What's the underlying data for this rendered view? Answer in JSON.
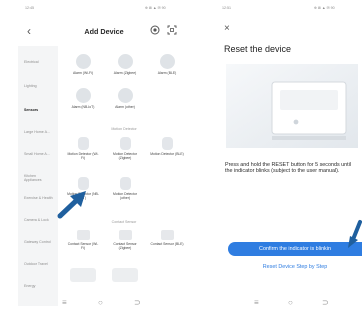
{
  "colors": {
    "accent": "#2f7de1",
    "arrow": "#1f5f9e",
    "sidebar_bg": "#f4f5f6"
  },
  "left": {
    "status_time": "12:45",
    "status_icons": "⊕ ⊠ ▲ ✉ 90",
    "title": "Add Device",
    "back_icon": "‹",
    "categories": [
      "Electrical",
      "Lighting",
      "Sensors",
      "Large Home A...",
      "Small Home A...",
      "Kitchen Appliances",
      "Exercise & Health",
      "Camera & Lock",
      "Gateway Control",
      "Outdoor Travel",
      "Energy"
    ],
    "active_category": "Sensors",
    "alarm_devices": [
      "Alarm (Wi-Fi)",
      "Alarm (Zigbee)",
      "Alarm (BLE)",
      "Alarm (NB-IoT)",
      "Alarm (other)"
    ],
    "motion_section_title": "Motion Detector",
    "motion_devices": [
      "Motion Detector (Wi-Fi)",
      "Motion Detector (Zigbee)",
      "Motion Detector (BLE)",
      "Motion Detector (NB-IoT)",
      "Motion Detector (other)"
    ],
    "contact_section_title": "Contact Sensor",
    "contact_devices": [
      "Contact Sensor (Wi-Fi)",
      "Contact Sensor (Zigbee)",
      "Contact Sensor (BLE)"
    ],
    "nav": [
      "≡",
      "○",
      "⊃"
    ]
  },
  "right": {
    "status_time": "12:51",
    "status_icons": "⊕ ⊠ ▲ ✉ 90",
    "close_icon": "×",
    "title": "Reset the device",
    "description": "Press and hold the RESET button for 5 seconds until the indicator blinks (subject to the user manual).",
    "confirm_button": "Confirm the indicator is blinkin",
    "reset_link": "Reset Device Step by Step",
    "nav": [
      "≡",
      "○",
      "⊃"
    ]
  }
}
